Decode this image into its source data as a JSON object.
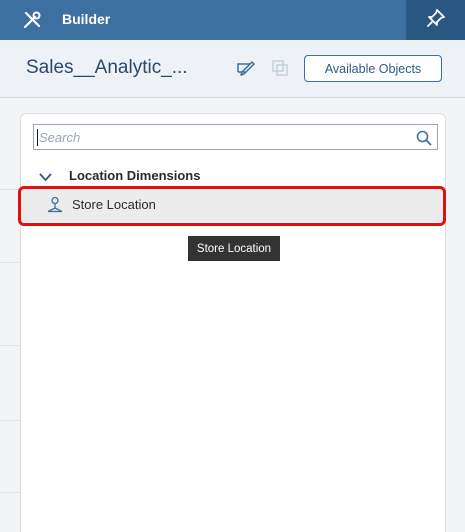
{
  "header": {
    "title": "Builder",
    "left_icon": "wrench-screwdriver-icon",
    "right_icon": "pin-icon"
  },
  "subheader": {
    "model_name": "Sales__Analytic_...",
    "edit_icon": "edit-icon",
    "copy_icon": "copy-icon",
    "available_objects_label": "Available Objects"
  },
  "search": {
    "placeholder": "Search",
    "icon": "search-icon"
  },
  "tree": {
    "group_label": "Location Dimensions",
    "items": [
      {
        "label": "Store Location",
        "icon": "geo-dimension-icon"
      }
    ]
  },
  "tooltip": {
    "text": "Store Location"
  },
  "colors": {
    "header_bg": "#3d6fa0",
    "header_active": "#2a5682",
    "highlight": "#e21010",
    "tooltip_bg": "#333333"
  }
}
